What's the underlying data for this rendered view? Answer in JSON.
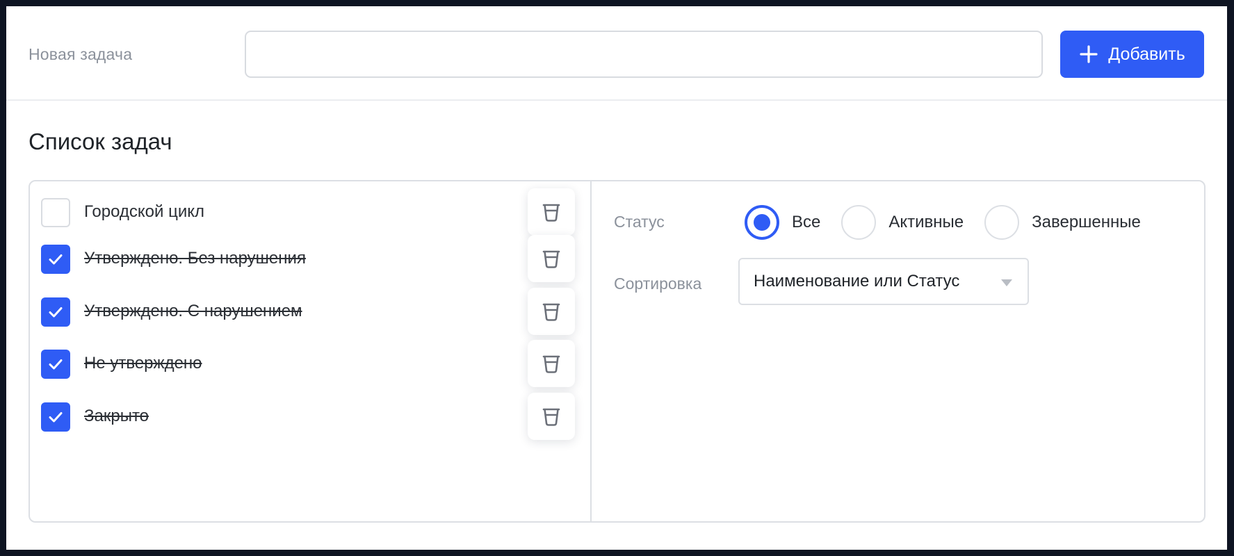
{
  "header": {
    "new_task_label": "Новая задача",
    "new_task_value": "",
    "add_button_label": "Добавить"
  },
  "section_title": "Список задач",
  "tasks": [
    {
      "label": "Городской цикл",
      "completed": false
    },
    {
      "label": "Утверждено. Без нарушения",
      "completed": true
    },
    {
      "label": "Утверждено. С нарушением",
      "completed": true
    },
    {
      "label": "Не утверждено",
      "completed": true
    },
    {
      "label": "Закрыто",
      "completed": true
    }
  ],
  "filters": {
    "status_label": "Статус",
    "status_options": [
      {
        "label": "Все",
        "selected": true
      },
      {
        "label": "Активные",
        "selected": false
      },
      {
        "label": "Завершенные",
        "selected": false
      }
    ],
    "sort_label": "Сортировка",
    "sort_value": "Наименование или Статус"
  },
  "icons": {
    "add": "plus-icon",
    "delete": "trash-icon",
    "check": "check-icon",
    "dropdown": "caret-down-icon"
  },
  "colors": {
    "accent": "#2f5cf5",
    "muted_text": "#8b919b",
    "border": "#dcdfe4",
    "text": "#1f2328",
    "frame_background": "#0e1422"
  }
}
